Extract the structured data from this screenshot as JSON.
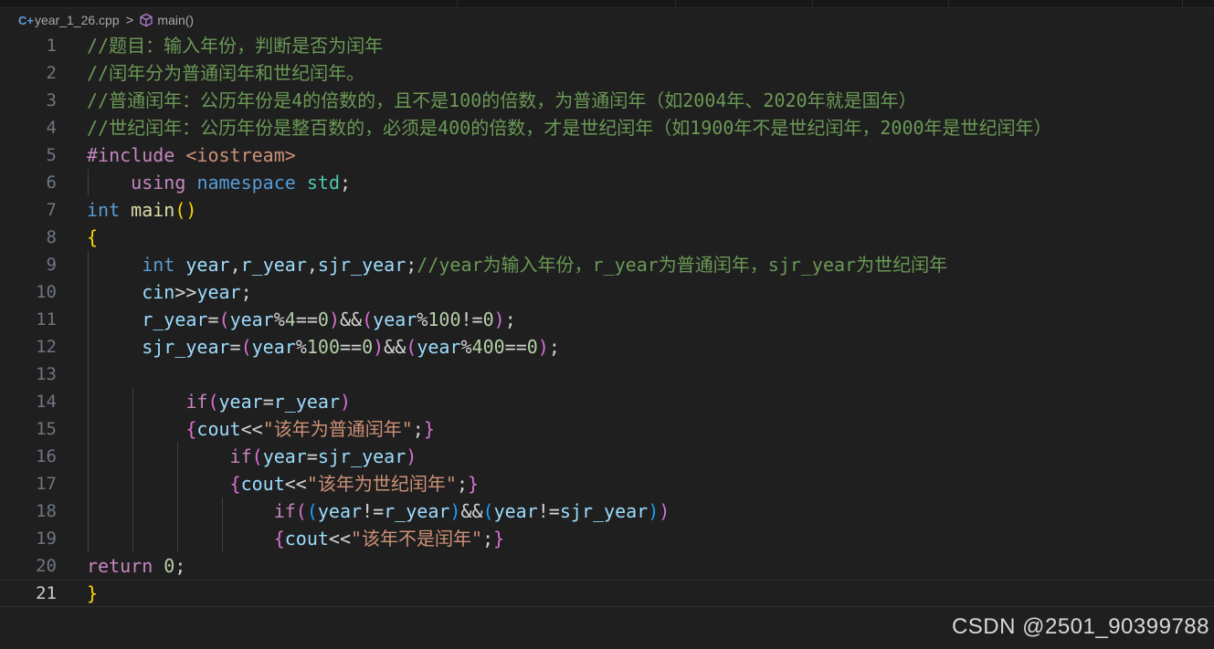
{
  "breadcrumb": {
    "file_icon_glyph": "C+",
    "file_icon": "cpp-file-icon",
    "file_name": "year_1_26.cpp",
    "separator": ">",
    "symbol_icon": "method-cube-icon",
    "symbol_name": "main()"
  },
  "editor": {
    "active_line": 21,
    "line_numbers": [
      "1",
      "2",
      "3",
      "4",
      "5",
      "6",
      "7",
      "8",
      "9",
      "10",
      "11",
      "12",
      "13",
      "14",
      "15",
      "16",
      "17",
      "18",
      "19",
      "20",
      "21"
    ],
    "lines": [
      [
        {
          "t": "//题目：输入年份，判断是否为闰年",
          "c": "com"
        }
      ],
      [
        {
          "t": "//闰年分为普通闰年和世纪闰年。",
          "c": "com"
        }
      ],
      [
        {
          "t": "//普通闰年：公历年份是4的倍数的，且不是100的倍数，为普通闰年（如2004年、2020年就是国年）",
          "c": "com"
        }
      ],
      [
        {
          "t": "//世纪闰年：公历年份是整百数的，必须是400的倍数，才是世纪闰年（如1900年不是世纪闰年，2000年是世纪闰年）",
          "c": "com"
        }
      ],
      [
        {
          "t": "#include ",
          "c": "pre"
        },
        {
          "t": "<iostream>",
          "c": "str"
        }
      ],
      [
        {
          "t": "    ",
          "c": "op"
        },
        {
          "t": "using",
          "c": "ctl"
        },
        {
          "t": " ",
          "c": "op"
        },
        {
          "t": "namespace",
          "c": "kw"
        },
        {
          "t": " ",
          "c": "op"
        },
        {
          "t": "std",
          "c": "ns"
        },
        {
          "t": ";",
          "c": "op"
        }
      ],
      [
        {
          "t": "int",
          "c": "kw"
        },
        {
          "t": " ",
          "c": "op"
        },
        {
          "t": "main",
          "c": "fn"
        },
        {
          "t": "()",
          "c": "b1"
        }
      ],
      [
        {
          "t": "{",
          "c": "b1"
        }
      ],
      [
        {
          "t": "     ",
          "c": "op"
        },
        {
          "t": "int",
          "c": "kw"
        },
        {
          "t": " ",
          "c": "op"
        },
        {
          "t": "year",
          "c": "var"
        },
        {
          "t": ",",
          "c": "op"
        },
        {
          "t": "r_year",
          "c": "var"
        },
        {
          "t": ",",
          "c": "op"
        },
        {
          "t": "sjr_year",
          "c": "var"
        },
        {
          "t": ";",
          "c": "op"
        },
        {
          "t": "//year为输入年份，r_year为普通闰年，sjr_year为世纪闰年",
          "c": "com"
        }
      ],
      [
        {
          "t": "     ",
          "c": "op"
        },
        {
          "t": "cin",
          "c": "var"
        },
        {
          "t": ">>",
          "c": "op"
        },
        {
          "t": "year",
          "c": "var"
        },
        {
          "t": ";",
          "c": "op"
        }
      ],
      [
        {
          "t": "     ",
          "c": "op"
        },
        {
          "t": "r_year",
          "c": "var"
        },
        {
          "t": "=",
          "c": "op"
        },
        {
          "t": "(",
          "c": "b2"
        },
        {
          "t": "year",
          "c": "var"
        },
        {
          "t": "%",
          "c": "op"
        },
        {
          "t": "4",
          "c": "num"
        },
        {
          "t": "==",
          "c": "op"
        },
        {
          "t": "0",
          "c": "num"
        },
        {
          "t": ")",
          "c": "b2"
        },
        {
          "t": "&&",
          "c": "op"
        },
        {
          "t": "(",
          "c": "b2"
        },
        {
          "t": "year",
          "c": "var"
        },
        {
          "t": "%",
          "c": "op"
        },
        {
          "t": "100",
          "c": "num"
        },
        {
          "t": "!=",
          "c": "op"
        },
        {
          "t": "0",
          "c": "num"
        },
        {
          "t": ")",
          "c": "b2"
        },
        {
          "t": ";",
          "c": "op"
        }
      ],
      [
        {
          "t": "     ",
          "c": "op"
        },
        {
          "t": "sjr_year",
          "c": "var"
        },
        {
          "t": "=",
          "c": "op"
        },
        {
          "t": "(",
          "c": "b2"
        },
        {
          "t": "year",
          "c": "var"
        },
        {
          "t": "%",
          "c": "op"
        },
        {
          "t": "100",
          "c": "num"
        },
        {
          "t": "==",
          "c": "op"
        },
        {
          "t": "0",
          "c": "num"
        },
        {
          "t": ")",
          "c": "b2"
        },
        {
          "t": "&&",
          "c": "op"
        },
        {
          "t": "(",
          "c": "b2"
        },
        {
          "t": "year",
          "c": "var"
        },
        {
          "t": "%",
          "c": "op"
        },
        {
          "t": "400",
          "c": "num"
        },
        {
          "t": "==",
          "c": "op"
        },
        {
          "t": "0",
          "c": "num"
        },
        {
          "t": ")",
          "c": "b2"
        },
        {
          "t": ";",
          "c": "op"
        }
      ],
      [],
      [
        {
          "t": "         ",
          "c": "op"
        },
        {
          "t": "if",
          "c": "ctl"
        },
        {
          "t": "(",
          "c": "b2"
        },
        {
          "t": "year",
          "c": "var"
        },
        {
          "t": "=",
          "c": "op"
        },
        {
          "t": "r_year",
          "c": "var"
        },
        {
          "t": ")",
          "c": "b2"
        }
      ],
      [
        {
          "t": "         ",
          "c": "op"
        },
        {
          "t": "{",
          "c": "b2"
        },
        {
          "t": "cout",
          "c": "var"
        },
        {
          "t": "<<",
          "c": "op"
        },
        {
          "t": "\"该年为普通闰年\"",
          "c": "str"
        },
        {
          "t": ";",
          "c": "op"
        },
        {
          "t": "}",
          "c": "b2"
        }
      ],
      [
        {
          "t": "             ",
          "c": "op"
        },
        {
          "t": "if",
          "c": "ctl"
        },
        {
          "t": "(",
          "c": "b2"
        },
        {
          "t": "year",
          "c": "var"
        },
        {
          "t": "=",
          "c": "op"
        },
        {
          "t": "sjr_year",
          "c": "var"
        },
        {
          "t": ")",
          "c": "b2"
        }
      ],
      [
        {
          "t": "             ",
          "c": "op"
        },
        {
          "t": "{",
          "c": "b2"
        },
        {
          "t": "cout",
          "c": "var"
        },
        {
          "t": "<<",
          "c": "op"
        },
        {
          "t": "\"该年为世纪闰年\"",
          "c": "str"
        },
        {
          "t": ";",
          "c": "op"
        },
        {
          "t": "}",
          "c": "b2"
        }
      ],
      [
        {
          "t": "                 ",
          "c": "op"
        },
        {
          "t": "if",
          "c": "ctl"
        },
        {
          "t": "(",
          "c": "b2"
        },
        {
          "t": "(",
          "c": "b3"
        },
        {
          "t": "year",
          "c": "var"
        },
        {
          "t": "!=",
          "c": "op"
        },
        {
          "t": "r_year",
          "c": "var"
        },
        {
          "t": ")",
          "c": "b3"
        },
        {
          "t": "&&",
          "c": "op"
        },
        {
          "t": "(",
          "c": "b3"
        },
        {
          "t": "year",
          "c": "var"
        },
        {
          "t": "!=",
          "c": "op"
        },
        {
          "t": "sjr_year",
          "c": "var"
        },
        {
          "t": ")",
          "c": "b3"
        },
        {
          "t": ")",
          "c": "b2"
        }
      ],
      [
        {
          "t": "                 ",
          "c": "op"
        },
        {
          "t": "{",
          "c": "b2"
        },
        {
          "t": "cout",
          "c": "var"
        },
        {
          "t": "<<",
          "c": "op"
        },
        {
          "t": "\"该年不是闰年\"",
          "c": "str"
        },
        {
          "t": ";",
          "c": "op"
        },
        {
          "t": "}",
          "c": "b2"
        }
      ],
      [
        {
          "t": "return",
          "c": "ctl"
        },
        {
          "t": " ",
          "c": "op"
        },
        {
          "t": "0",
          "c": "num"
        },
        {
          "t": ";",
          "c": "op"
        }
      ],
      [
        {
          "t": "}",
          "c": "b1"
        }
      ]
    ]
  },
  "watermark": "CSDN @2501_90399788"
}
